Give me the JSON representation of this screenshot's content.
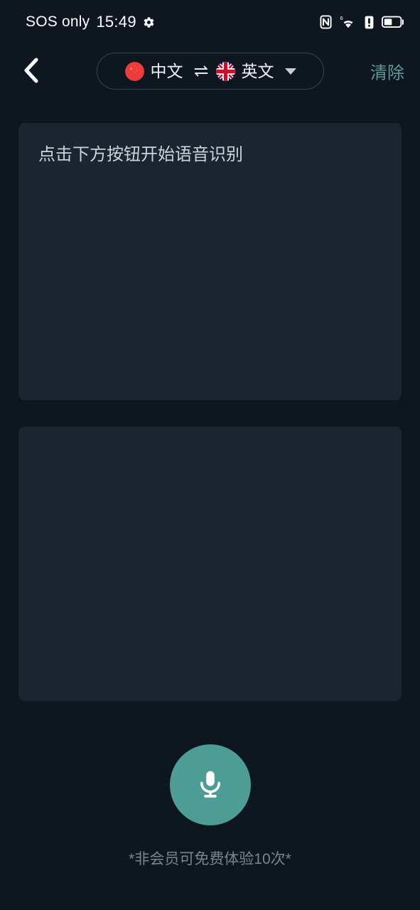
{
  "statusbar": {
    "carrier": "SOS only",
    "time": "15:49",
    "gear_icon": "gear-icon",
    "nfc_icon": "nfc-icon",
    "wifi_icon": "wifi-6-icon",
    "alert_icon": "alert-icon",
    "battery_icon": "battery-icon"
  },
  "header": {
    "back_icon": "chevron-left-icon",
    "source_lang": "中文",
    "source_flag": "china-flag-icon",
    "swap_icon": "swap-arrows-icon",
    "target_lang": "英文",
    "target_flag": "uk-flag-icon",
    "caret_icon": "chevron-down-icon",
    "clear_label": "清除",
    "clear_color": "#5f9b99"
  },
  "main": {
    "input_panel_text": "点击下方按钮开始语音识别",
    "output_panel_text": "",
    "panel_bg": "#1b2530"
  },
  "footer": {
    "mic_icon": "microphone-icon",
    "mic_color": "#4d9c95",
    "hint": "*非会员可免费体验10次*"
  },
  "theme": {
    "background": "#0e1720",
    "accent": "#4d9c95"
  }
}
